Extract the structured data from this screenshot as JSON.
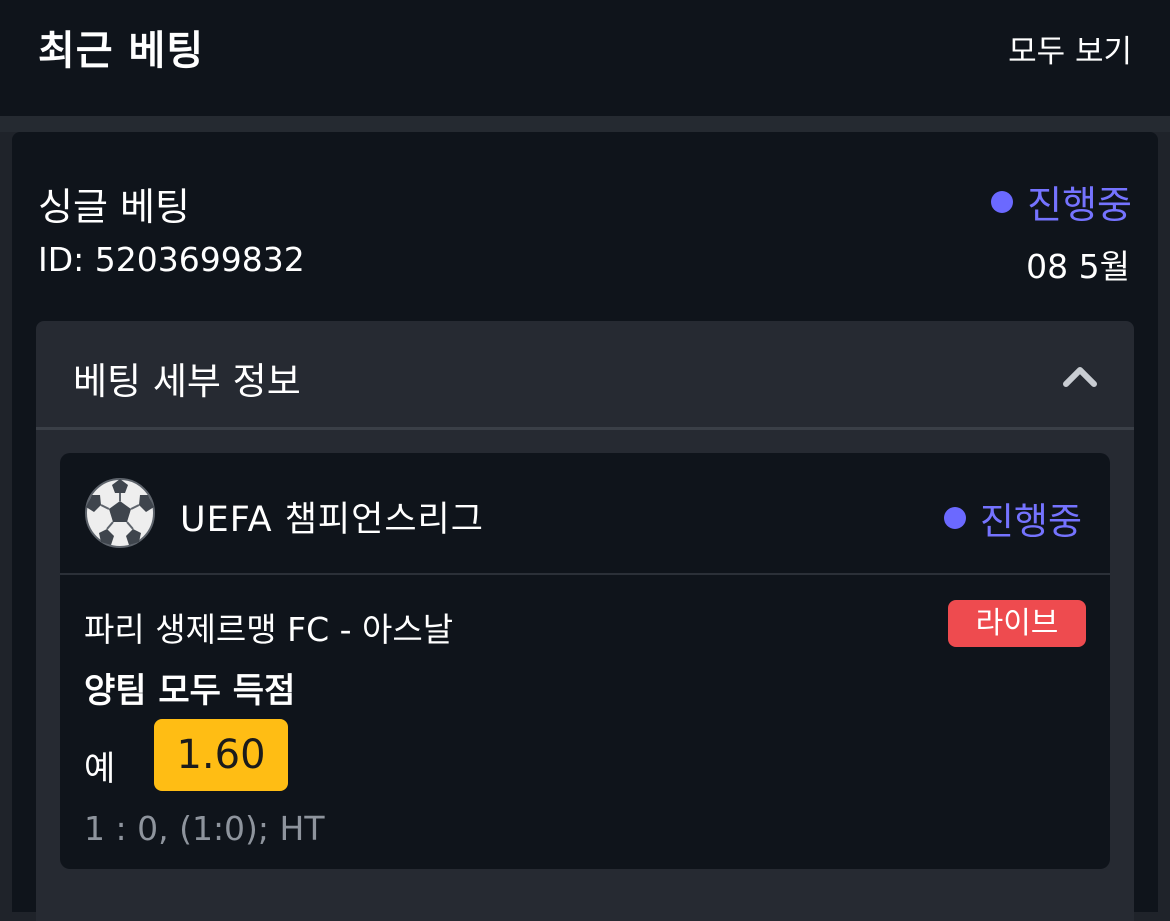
{
  "header": {
    "title": "최근 베팅",
    "view_all": "모두 보기"
  },
  "bet": {
    "type": "싱글 베팅",
    "status": "진행중",
    "id_label": "ID: 5203699832",
    "date": "08 5월"
  },
  "details": {
    "label": "베팅 세부 정보",
    "expanded": true,
    "event": {
      "league": "UEFA 챔피언스리그",
      "status": "진행중",
      "match": "파리 생제르맹 FC - 아스날",
      "live_badge": "라이브",
      "market": "양팀 모두 득점",
      "selection": "예",
      "odds": "1.60",
      "score": "1 : 0, (1:0); HT"
    }
  },
  "colors": {
    "background": "#0f141b",
    "panel": "#262a32",
    "status": "#7573ff",
    "live": "#ee4b4f",
    "odds": "#ffbd14"
  },
  "icons": {
    "collapse": "chevron-up-icon",
    "sport": "soccer-ball-icon",
    "status": "status-dot-icon"
  }
}
